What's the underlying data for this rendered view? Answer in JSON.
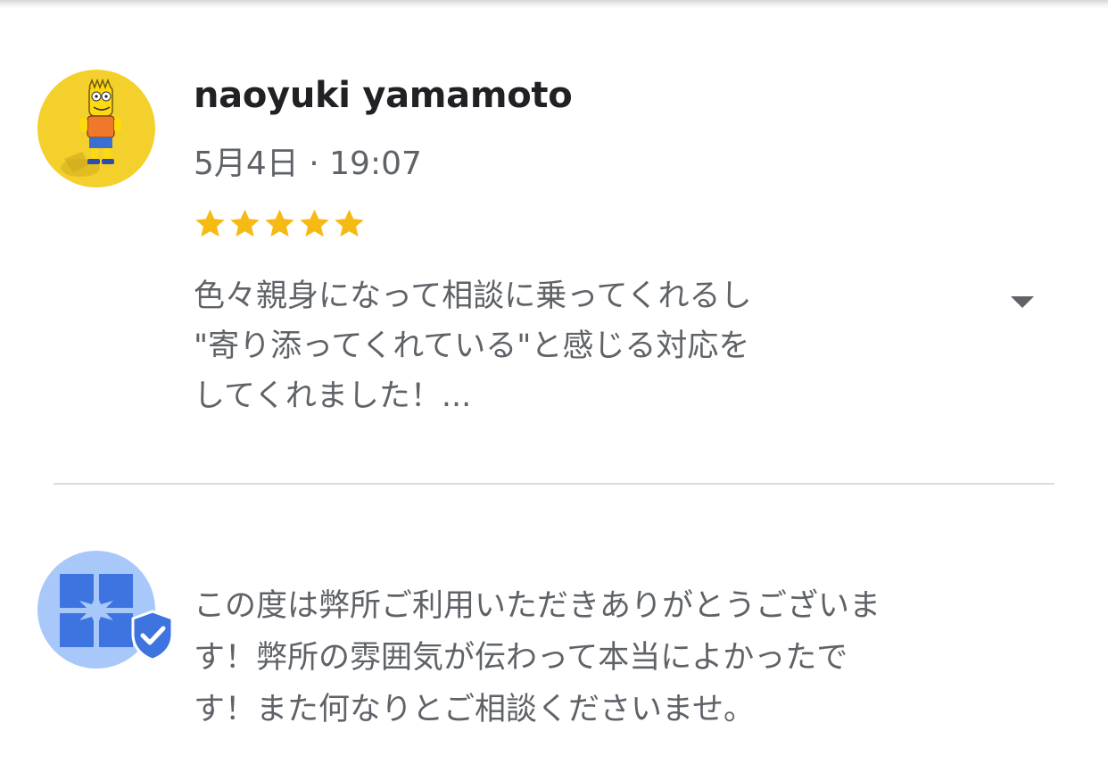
{
  "review": {
    "reviewer_name": "naoyuki yamamoto",
    "date": "5月4日 · 19:07",
    "rating": 5,
    "rating_max": 5,
    "text_lines": [
      "色々親身になって相談に乗ってくれるし",
      "\"寄り添ってくれている\"と感じる対応を",
      "してくれました！..."
    ],
    "expand_icon": "chevron-down-icon"
  },
  "owner_reply": {
    "avatar_icon": "business-logo-icon",
    "badge_icon": "verified-shield-icon",
    "text_lines": [
      "この度は弊所ご利用いただきありがとうございま",
      "す！弊所の雰囲気が伝わって本当によかったで",
      "す！また何なりとご相談くださいませ。"
    ]
  },
  "colors": {
    "star": "#F5BA14",
    "avatar_background": "#F4D02C",
    "owner_avatar_background": "#A8C8FA",
    "brand_blue": "#3E74E0",
    "text_primary": "#202124",
    "text_secondary": "#5F6368",
    "divider": "#DADCE0"
  }
}
